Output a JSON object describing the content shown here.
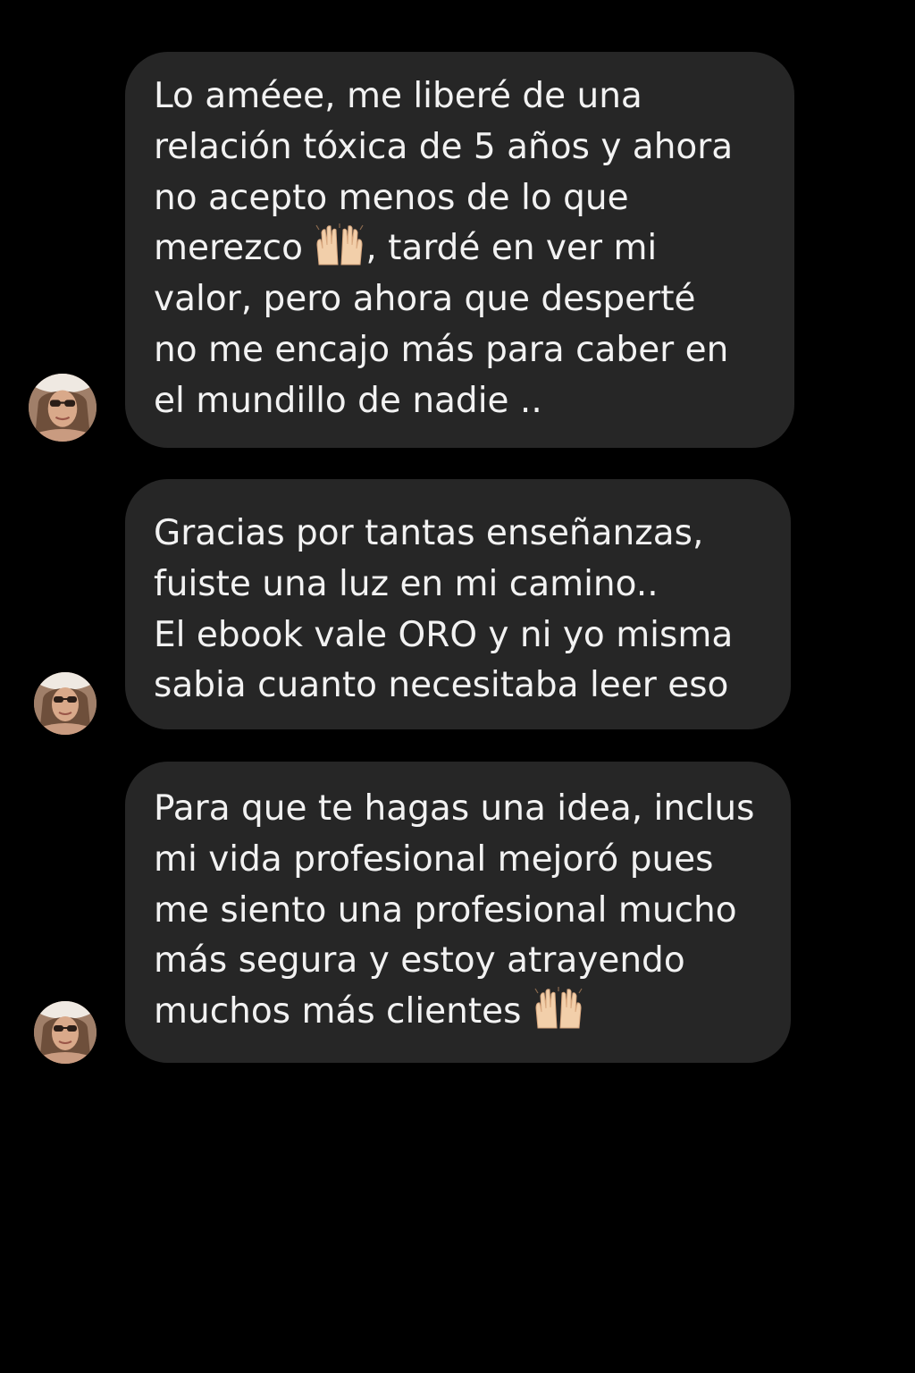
{
  "conversation": {
    "messages": [
      {
        "lines": [
          "Lo améee, me liberé de una",
          "relación tóxica de 5 años y ahora",
          "no acepto menos de lo que",
          "merezco",
          ", tardé en ver mi",
          "valor, pero ahora que desperté",
          "no me encajo más para caber en",
          "el mundillo de nadie .."
        ],
        "emoji": "raising-hands-emoji"
      },
      {
        "lines": [
          "Gracias por tantas enseñanzas,",
          "fuiste una luz en mi camino..",
          "El ebook vale ORO y ni yo misma",
          "sabia cuanto necesitaba leer eso"
        ]
      },
      {
        "lines": [
          "Para que te hagas una idea, inclus",
          "mi vida profesional mejoró pues",
          "me siento una profesional mucho",
          "más segura y estoy atrayendo",
          "muchos más clientes"
        ],
        "emoji": "raising-hands-emoji"
      }
    ],
    "sender_avatar": "profile-photo-avatar"
  },
  "colors": {
    "background": "#000000",
    "bubble": "#262626",
    "text": "#f2f2f2",
    "skin": "#f2cfaa"
  }
}
